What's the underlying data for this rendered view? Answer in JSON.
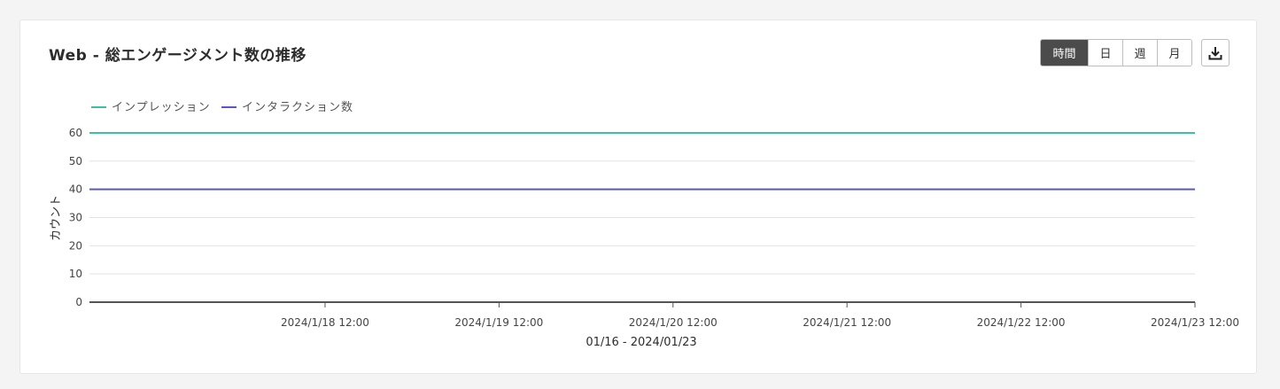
{
  "card": {
    "title": "Web - 総エンゲージメント数の推移"
  },
  "period_buttons": [
    {
      "label": "時間",
      "active": true
    },
    {
      "label": "日",
      "active": false
    },
    {
      "label": "週",
      "active": false
    },
    {
      "label": "月",
      "active": false
    }
  ],
  "download_button": {
    "icon": "download-icon"
  },
  "chart_data": {
    "type": "line",
    "title": "",
    "ylabel": "カウント",
    "xlabel": "01/16 - 2024/01/23",
    "ylim": [
      0,
      60
    ],
    "yticks": [
      0,
      10,
      20,
      30,
      40,
      50,
      60
    ],
    "xlim": [
      "2024/1/17 03:30",
      "2024/1/23 12:00"
    ],
    "xticks": [
      "2024/1/18 12:00",
      "2024/1/19 12:00",
      "2024/1/20 12:00",
      "2024/1/21 12:00",
      "2024/1/22 12:00",
      "2024/1/23 12:00"
    ],
    "grid": true,
    "legend_position": "top-left",
    "series": [
      {
        "name": "インプレッション",
        "color": "#3fbfa8",
        "x": [
          "2024/1/17 03:30",
          "2024/1/23 12:00"
        ],
        "values": [
          60,
          60
        ]
      },
      {
        "name": "インタラクション数",
        "color": "#5a57c4",
        "x": [
          "2024/1/17 03:30",
          "2024/1/23 12:00"
        ],
        "values": [
          40,
          40
        ]
      }
    ]
  }
}
